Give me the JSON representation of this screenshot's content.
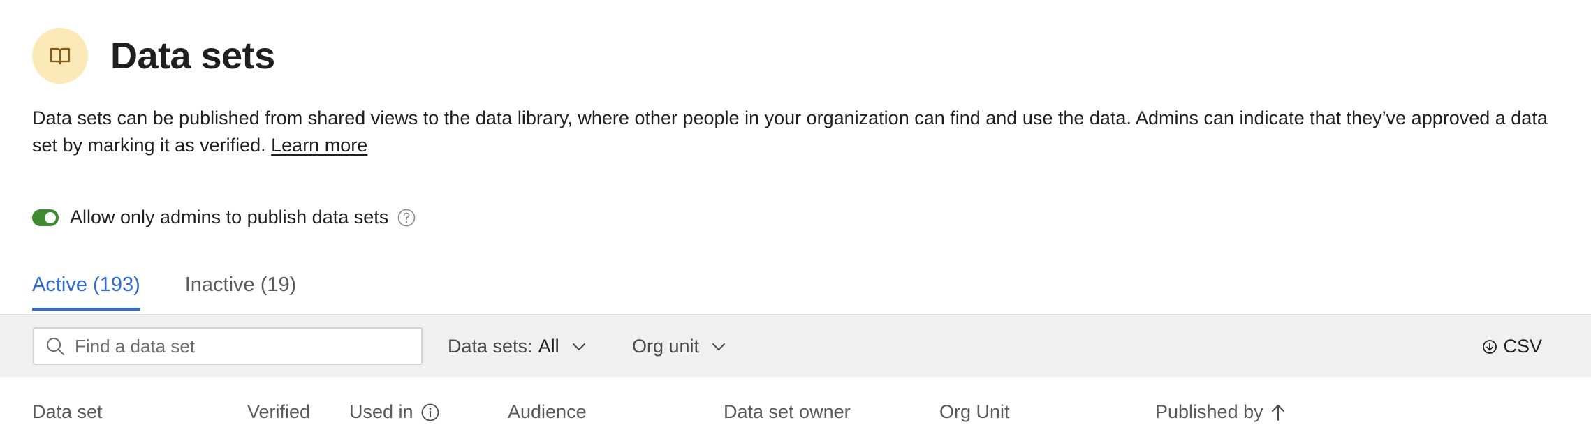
{
  "header": {
    "icon": "book-icon",
    "title": "Data sets",
    "icon_bg": "#fbe9b7"
  },
  "description": {
    "text": "Data sets can be published from shared views to the data library, where other people in your organization can find and use the data. Admins can indicate that they’ve approved a data set by marking it as verified. ",
    "link_label": "Learn more"
  },
  "setting": {
    "label": "Allow only admins to publish data sets",
    "enabled": true,
    "toggle_color": "#3f8a2e",
    "help_icon": "help-circle-icon"
  },
  "tabs": [
    {
      "label": "Active (193)",
      "active": true
    },
    {
      "label": "Inactive (19)",
      "active": false
    }
  ],
  "accent_color": "#2d6bd6",
  "toolbar": {
    "search_placeholder": "Find a data set",
    "search_value": "",
    "filter_datasets_label": "Data sets:",
    "filter_datasets_value": "All",
    "filter_org_label": "Org unit",
    "csv_label": "CSV"
  },
  "table": {
    "columns": [
      {
        "label": "Data set"
      },
      {
        "label": "Verified"
      },
      {
        "label": "Used in",
        "icon": "info-icon"
      },
      {
        "label": "Audience"
      },
      {
        "label": "Data set owner"
      },
      {
        "label": "Org Unit"
      },
      {
        "label": "Published by",
        "icon": "sort-ascending-arrow-icon"
      }
    ]
  }
}
